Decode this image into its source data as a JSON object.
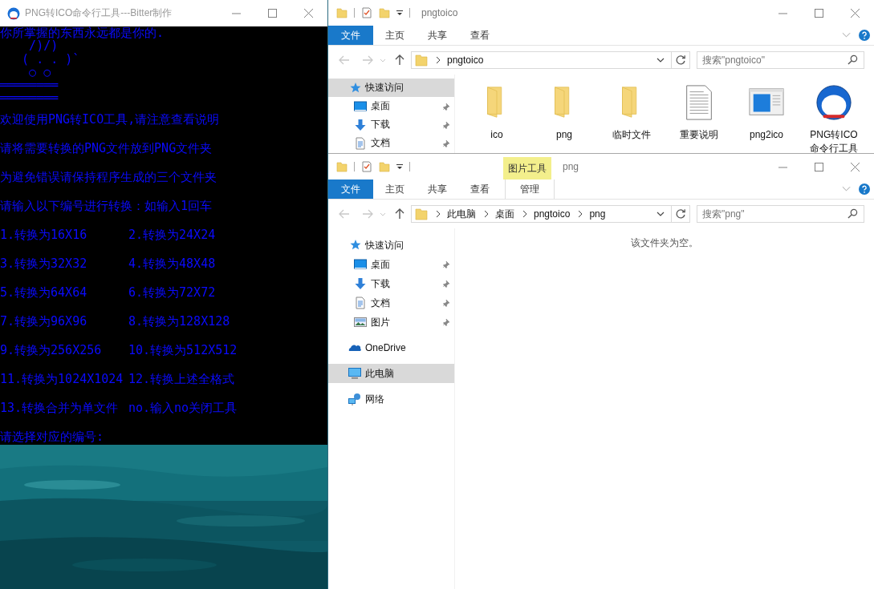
{
  "console": {
    "title": "PNG转ICO命令行工具---Bitter制作",
    "lines": [
      {
        "kind": "art",
        "text": "你所掌握的东西永远都是你的."
      },
      {
        "kind": "art",
        "text": "    /)/)"
      },
      {
        "kind": "art",
        "text": "   ( . . )`"
      },
      {
        "kind": "art",
        "text": "    ○ ○"
      },
      {
        "kind": "art",
        "text": "════════"
      },
      {
        "kind": "art",
        "text": "════════"
      },
      {
        "kind": "text",
        "text": "欢迎使用PNG转ICO工具,请注意查看说明"
      },
      {
        "kind": "text",
        "text": "请将需要转换的PNG文件放到PNG文件夹"
      },
      {
        "kind": "text",
        "text": "为避免错误请保持程序生成的三个文件夹"
      },
      {
        "kind": "text",
        "text": "请输入以下编号进行转换：如输入1回车"
      },
      {
        "kind": "pair",
        "left": "1.转换为16X16",
        "right": "2.转换为24X24"
      },
      {
        "kind": "pair",
        "left": "3.转换为32X32",
        "right": "4.转换为48X48"
      },
      {
        "kind": "pair",
        "left": "5.转换为64X64",
        "right": "6.转换为72X72"
      },
      {
        "kind": "pair",
        "left": "7.转换为96X96",
        "right": "8.转换为128X128"
      },
      {
        "kind": "pair",
        "left": "9.转换为256X256",
        "right": "10.转换为512X512"
      },
      {
        "kind": "pair",
        "left": "11.转换为1024X1024",
        "right": "12.转换上述全格式"
      },
      {
        "kind": "pair",
        "left": "13.转换合并为单文件",
        "right": "no.输入no关闭工具"
      },
      {
        "kind": "text",
        "text": "请选择对应的编号:"
      }
    ]
  },
  "explorers": [
    {
      "title": "pngtoico",
      "tabs": [
        {
          "label": "文件",
          "selected": true,
          "contextual": false
        },
        {
          "label": "主页",
          "selected": false,
          "contextual": false
        },
        {
          "label": "共享",
          "selected": false,
          "contextual": false
        },
        {
          "label": "查看",
          "selected": false,
          "contextual": false
        }
      ],
      "address": [
        "pngtoico"
      ],
      "search_placeholder": "搜索\"pngtoico\"",
      "nav": [
        {
          "label": "快速访问",
          "kind": "star",
          "selected": true,
          "pinned": false,
          "children": [
            {
              "label": "桌面",
              "kind": "desktop",
              "selected": false,
              "pinned": true
            },
            {
              "label": "下载",
              "kind": "download",
              "selected": false,
              "pinned": true
            },
            {
              "label": "文档",
              "kind": "document",
              "selected": false,
              "pinned": true
            }
          ]
        }
      ],
      "items": [
        {
          "name": "ico",
          "kind": "folder"
        },
        {
          "name": "png",
          "kind": "folder"
        },
        {
          "name": "临时文件",
          "kind": "folder"
        },
        {
          "name": "重要说明",
          "kind": "text"
        },
        {
          "name": "png2ico",
          "kind": "window"
        },
        {
          "name": "PNG转ICO命令行工具",
          "kind": "app"
        }
      ]
    },
    {
      "title": "png",
      "context_tab": "图片工具",
      "tabs": [
        {
          "label": "文件",
          "selected": true,
          "contextual": false
        },
        {
          "label": "主页",
          "selected": false,
          "contextual": false
        },
        {
          "label": "共享",
          "selected": false,
          "contextual": false
        },
        {
          "label": "查看",
          "selected": false,
          "contextual": false
        },
        {
          "label": "管理",
          "selected": false,
          "contextual": true
        }
      ],
      "address": [
        "此电脑",
        "桌面",
        "pngtoico",
        "png"
      ],
      "search_placeholder": "搜索\"png\"",
      "nav": [
        {
          "label": "快速访问",
          "kind": "star",
          "selected": false,
          "pinned": false,
          "children": [
            {
              "label": "桌面",
              "kind": "desktop",
              "selected": false,
              "pinned": true
            },
            {
              "label": "下载",
              "kind": "download",
              "selected": false,
              "pinned": true
            },
            {
              "label": "文档",
              "kind": "document",
              "selected": false,
              "pinned": true
            },
            {
              "label": "图片",
              "kind": "pictures",
              "selected": false,
              "pinned": true
            }
          ]
        },
        {
          "label": "OneDrive",
          "kind": "cloud",
          "selected": false,
          "pinned": false
        },
        {
          "label": "此电脑",
          "kind": "computer",
          "selected": true,
          "pinned": false
        },
        {
          "label": "网络",
          "kind": "network",
          "selected": false,
          "pinned": false
        }
      ],
      "empty_message": "该文件夹为空。"
    }
  ]
}
